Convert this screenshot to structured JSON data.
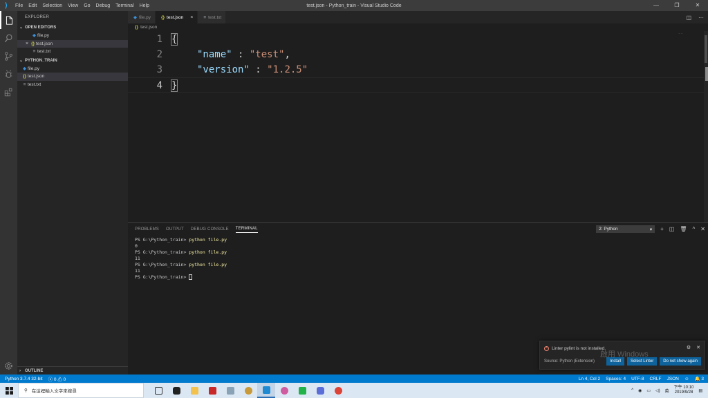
{
  "titlebar": {
    "menu": [
      "File",
      "Edit",
      "Selection",
      "View",
      "Go",
      "Debug",
      "Terminal",
      "Help"
    ],
    "title": "test.json - Python_train - Visual Studio Code"
  },
  "sidebar": {
    "title": "EXPLORER",
    "open_editors_header": "OPEN EDITORS",
    "open_editors": [
      {
        "name": "file.py",
        "icon": "python-file-icon"
      },
      {
        "name": "test.json",
        "icon": "json-file-icon"
      },
      {
        "name": "test.txt",
        "icon": "text-file-icon"
      }
    ],
    "folder_header": "PYTHON_TRAIN",
    "files": [
      {
        "name": "file.py",
        "icon": "python-file-icon"
      },
      {
        "name": "test.json",
        "icon": "json-file-icon"
      },
      {
        "name": "test.txt",
        "icon": "text-file-icon"
      }
    ],
    "outline_header": "OUTLINE"
  },
  "tabs": [
    {
      "label": "file.py",
      "icon": "python-file-icon",
      "active": false
    },
    {
      "label": "test.json",
      "icon": "json-file-icon",
      "active": true
    },
    {
      "label": "test.txt",
      "icon": "text-file-icon",
      "active": false
    }
  ],
  "breadcrumb": "test.json",
  "editor": {
    "line_numbers": [
      "1",
      "2",
      "3",
      "4"
    ],
    "lines": {
      "l1_brace": "{",
      "l2_key": "\"name\"",
      "l2_sep": " : ",
      "l2_val": "\"test\"",
      "l2_comma": ",",
      "l3_key": "\"version\"",
      "l3_sep": " : ",
      "l3_val": "\"1.2.5\"",
      "l4_brace": "}"
    }
  },
  "panel": {
    "tabs": [
      "PROBLEMS",
      "OUTPUT",
      "DEBUG CONSOLE",
      "TERMINAL"
    ],
    "active_tab": "TERMINAL",
    "terminal_select": "2: Python",
    "terminal_lines": [
      {
        "prompt": "PS G:\\Python_train> ",
        "cmd": "python file.py"
      },
      {
        "output": "0"
      },
      {
        "prompt": "PS G:\\Python_train> ",
        "cmd": "python file.py"
      },
      {
        "output": "11"
      },
      {
        "prompt": "PS G:\\Python_train> ",
        "cmd": "python file.py"
      },
      {
        "output": "11"
      },
      {
        "prompt": "PS G:\\Python_train> ",
        "cmd": ""
      }
    ]
  },
  "notification": {
    "message": "Linter pylint is not installed.",
    "source": "Source: Python (Extension)",
    "buttons": [
      "Install",
      "Select Linter",
      "Do not show again"
    ]
  },
  "watermark": "啟用 Windows",
  "statusbar": {
    "python": "Python 3.7.4 32-bit",
    "errors": "0",
    "warnings": "0",
    "position": "Ln 4, Col 2",
    "spaces": "Spaces: 4",
    "encoding": "UTF-8",
    "eol": "CRLF",
    "language": "JSON",
    "notifications": "3"
  },
  "taskbar": {
    "search_placeholder": "在這裡輸入文字來搜尋",
    "time": "下午 10:10",
    "date": "2019/9/28",
    "ime": "英"
  },
  "colors": {
    "accent": "#007acc",
    "json_key": "#9cdcfe",
    "json_string": "#ce9178",
    "button": "#0e639c"
  }
}
